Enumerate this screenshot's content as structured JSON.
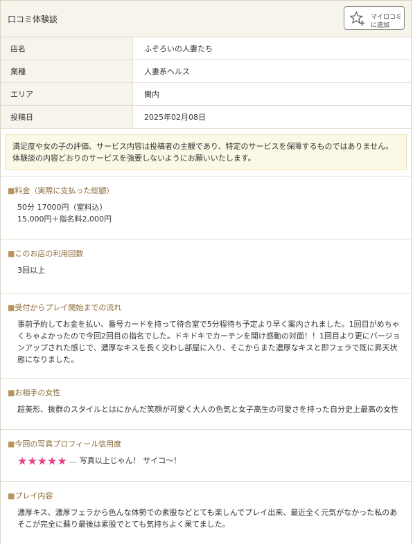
{
  "header": {
    "title": "口コミ体験談",
    "mykuchikomi_line1": "マイロコミ",
    "mykuchikomi_line2": "に追加"
  },
  "info": [
    {
      "key": "店名",
      "value": "ふぞろいの人妻たち"
    },
    {
      "key": "業種",
      "value": "人妻系ヘルス"
    },
    {
      "key": "エリア",
      "value": "関内"
    },
    {
      "key": "投稿日",
      "value": "2025年02月08日"
    }
  ],
  "notice": "満足度や女の子の評価、サービス内容は投稿者の主観であり、特定のサービスを保障するものではありません。体験談の内容どおりのサービスを強要しないようにお願いいたします。",
  "sections": {
    "price": {
      "heading": "料金（実際に支払った総額）",
      "line1": "50分 17000円（室料込）",
      "line2": "15,000円＋指名料2,000円"
    },
    "usage": {
      "heading": "このお店の利用回数",
      "text": "3回以上"
    },
    "flow": {
      "heading": "受付からプレイ開始までの流れ",
      "text": "事前予約してお金を払い、番号カードを持って待合室で5分程待ち予定より早く案内されました。1回目がめちゃくちゃよかったので今回2回目の指名でした。ドキドキでカーテンを開け感動の対面！！1回目より更にバージョンアップされた感じで、濃厚なキスを長く交わし部屋に入り、そこからまた濃厚なキスと即フェラで既に昇天状態になりました。"
    },
    "partner": {
      "heading": "お相手の女性",
      "text": "超美形、抜群のスタイルとはにかんだ笑顔が可愛く大人の色気と女子高生の可愛さを持った自分史上最高の女性"
    },
    "photo": {
      "heading": "今回の写真プロフィール信用度",
      "stars": "★★★★★",
      "rating": 5,
      "comment": "… 写真以上じゃん！ サイコ～！"
    },
    "play": {
      "heading": "プレイ内容",
      "text": "濃厚キス、濃厚フェラから色んな体勢での素股などとても楽しんでプレイ出来、最近全く元気がなかった私のあそこが完全に蘇り最後は素股でとても気持ちよく果てました。"
    }
  },
  "colors": {
    "accent_heading": "#8b6a3a",
    "star": "#e8418c",
    "header_bg": "#f7f4ec",
    "notice_bg": "#fcf8e6"
  }
}
